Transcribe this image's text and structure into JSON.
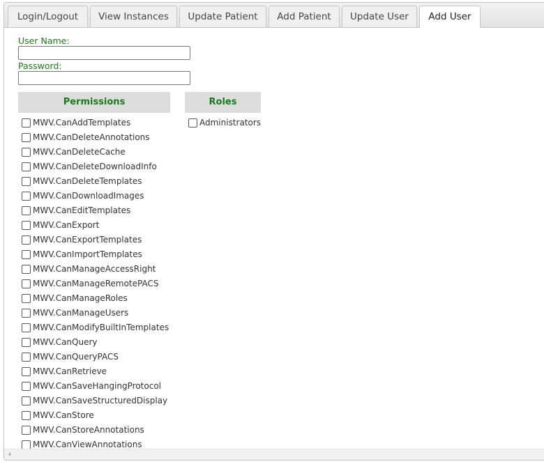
{
  "tabs": [
    {
      "label": "Login/Logout",
      "active": false
    },
    {
      "label": "View Instances",
      "active": false
    },
    {
      "label": "Update Patient",
      "active": false
    },
    {
      "label": "Add Patient",
      "active": false
    },
    {
      "label": "Update User",
      "active": false
    },
    {
      "label": "Add User",
      "active": true
    }
  ],
  "form": {
    "username_label": "User Name:",
    "username_value": "",
    "password_label": "Password:",
    "password_value": ""
  },
  "permissions": {
    "header": "Permissions",
    "items": [
      {
        "label": "MWV.CanAddTemplates",
        "checked": false
      },
      {
        "label": "MWV.CanDeleteAnnotations",
        "checked": false
      },
      {
        "label": "MWV.CanDeleteCache",
        "checked": false
      },
      {
        "label": "MWV.CanDeleteDownloadInfo",
        "checked": false
      },
      {
        "label": "MWV.CanDeleteTemplates",
        "checked": false
      },
      {
        "label": "MWV.CanDownloadImages",
        "checked": false
      },
      {
        "label": "MWV.CanEditTemplates",
        "checked": false
      },
      {
        "label": "MWV.CanExport",
        "checked": false
      },
      {
        "label": "MWV.CanExportTemplates",
        "checked": false
      },
      {
        "label": "MWV.CanImportTemplates",
        "checked": false
      },
      {
        "label": "MWV.CanManageAccessRight",
        "checked": false
      },
      {
        "label": "MWV.CanManageRemotePACS",
        "checked": false
      },
      {
        "label": "MWV.CanManageRoles",
        "checked": false
      },
      {
        "label": "MWV.CanManageUsers",
        "checked": false
      },
      {
        "label": "MWV.CanModifyBuiltInTemplates",
        "checked": false
      },
      {
        "label": "MWV.CanQuery",
        "checked": false
      },
      {
        "label": "MWV.CanQueryPACS",
        "checked": false
      },
      {
        "label": "MWV.CanRetrieve",
        "checked": false
      },
      {
        "label": "MWV.CanSaveHangingProtocol",
        "checked": false
      },
      {
        "label": "MWV.CanSaveStructuredDisplay",
        "checked": false
      },
      {
        "label": "MWV.CanStore",
        "checked": false
      },
      {
        "label": "MWV.CanStoreAnnotations",
        "checked": false
      },
      {
        "label": "MWV.CanViewAnnotations",
        "checked": false
      }
    ]
  },
  "roles": {
    "header": "Roles",
    "items": [
      {
        "label": "Administrators",
        "checked": false
      }
    ]
  },
  "colors": {
    "label_green": "#1a7a1a",
    "header_bg": "#dddddd"
  }
}
